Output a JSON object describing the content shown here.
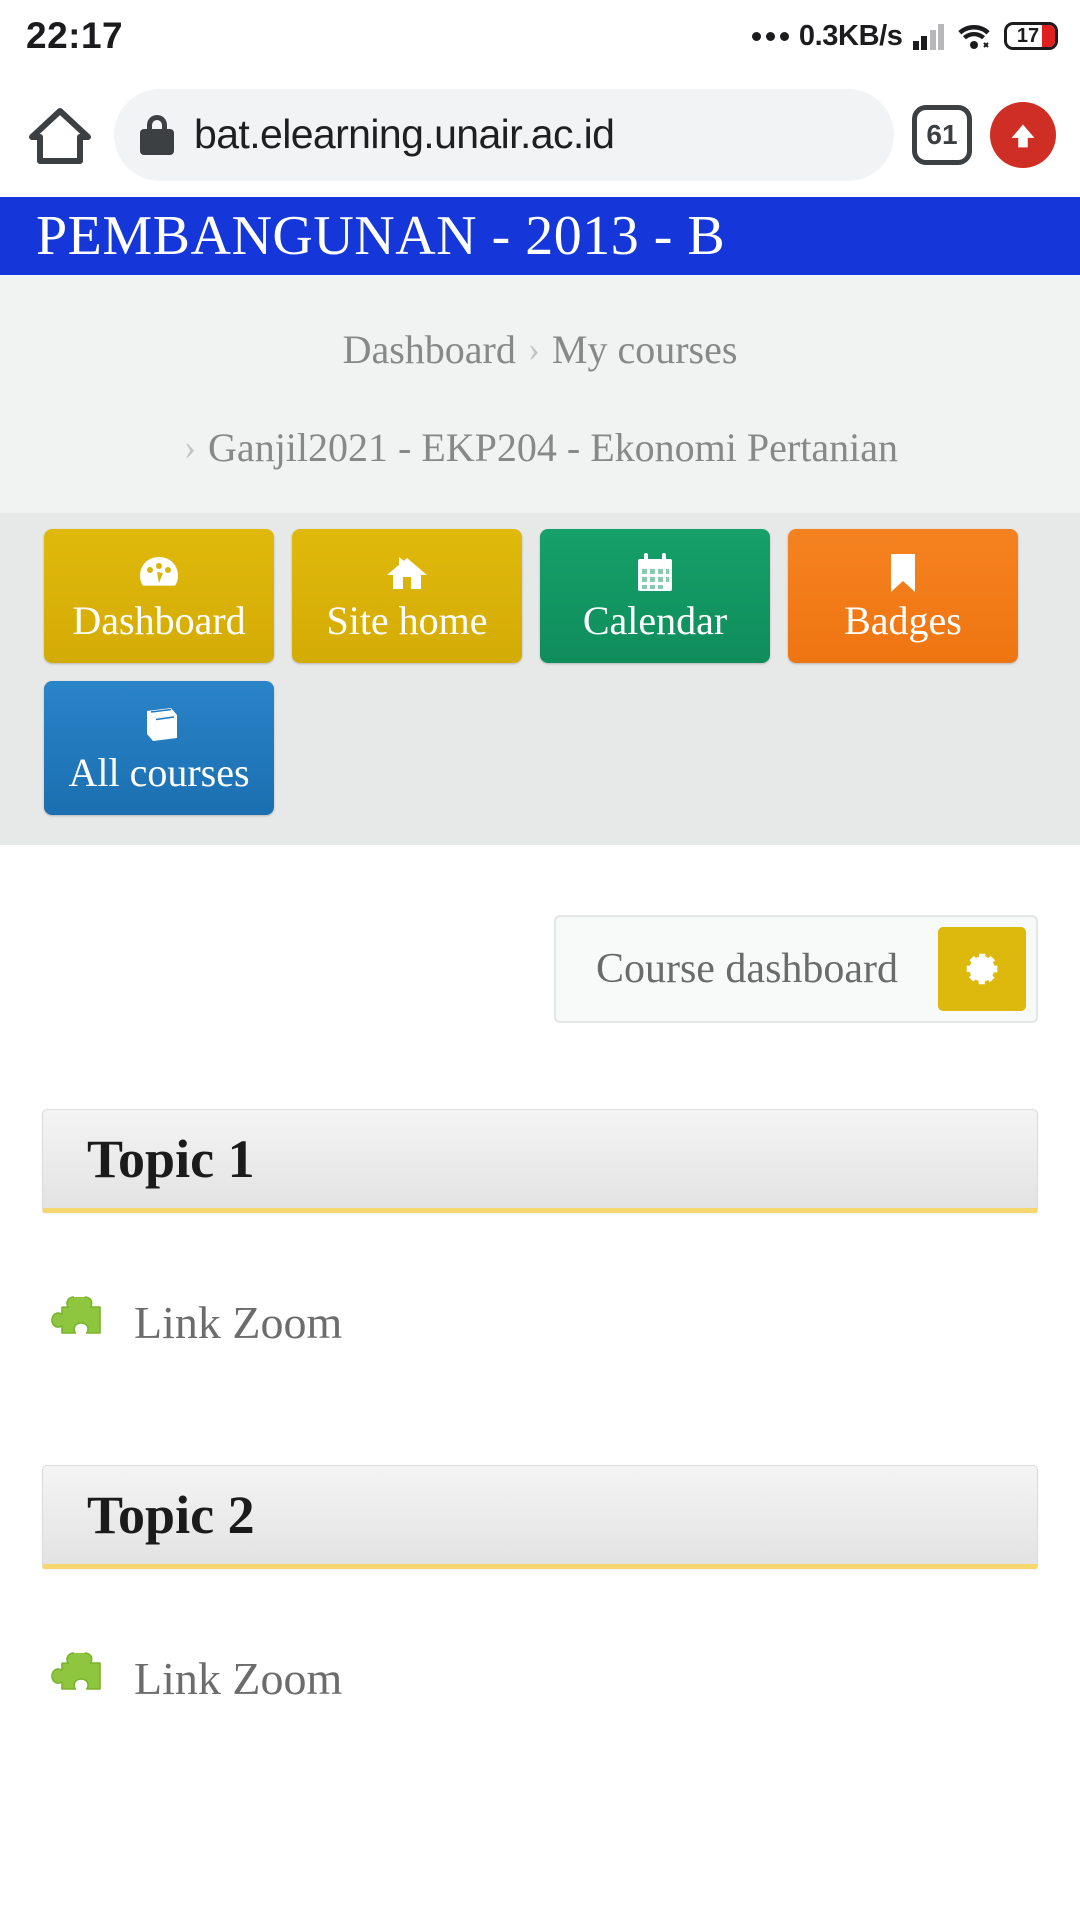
{
  "status_bar": {
    "time": "22:17",
    "network_speed": "0.3KB/s",
    "battery_level": "17",
    "icons": [
      "more-dots-icon",
      "signal-bars-icon",
      "wifi-icon",
      "battery-icon"
    ]
  },
  "browser": {
    "home_icon": "home-icon",
    "lock_icon": "lock-icon",
    "url": "bat.elearning.unair.ac.id",
    "tab_count": "61",
    "upload_icon": "upload-arrow-icon"
  },
  "page": {
    "title": "PEMBANGUNAN - 2013 - B",
    "header_color": "#1536d8"
  },
  "breadcrumb": {
    "rows": [
      {
        "items": [
          "Dashboard",
          "My courses"
        ],
        "separator": "›"
      },
      {
        "items": [
          "Ganjil2021 - EKP204 - Ekonomi Pertanian"
        ],
        "separator": "›",
        "leading_separator": true
      }
    ]
  },
  "nav_buttons": [
    {
      "label": "Dashboard",
      "icon": "tachometer-icon",
      "color": "#d9b40a",
      "style": "nav-gold"
    },
    {
      "label": "Site home",
      "icon": "home-icon",
      "color": "#d9b40a",
      "style": "nav-gold"
    },
    {
      "label": "Calendar",
      "icon": "calendar-icon",
      "color": "#12946180",
      "style": "nav-green"
    },
    {
      "label": "Badges",
      "icon": "bookmark-icon",
      "color": "#f27c16",
      "style": "nav-orange"
    },
    {
      "label": "All courses",
      "icon": "book-icon",
      "color": "#2176b8",
      "style": "nav-blue"
    }
  ],
  "course_selector": {
    "value": "Course dashboard",
    "gear_icon": "gear-icon",
    "gear_color": "#ddb80d"
  },
  "topics": [
    {
      "title": "Topic 1",
      "activities": [
        {
          "label": "Link Zoom",
          "icon": "puzzle-piece-icon"
        }
      ]
    },
    {
      "title": "Topic 2",
      "activities": [
        {
          "label": "Link Zoom",
          "icon": "puzzle-piece-icon"
        }
      ]
    }
  ]
}
